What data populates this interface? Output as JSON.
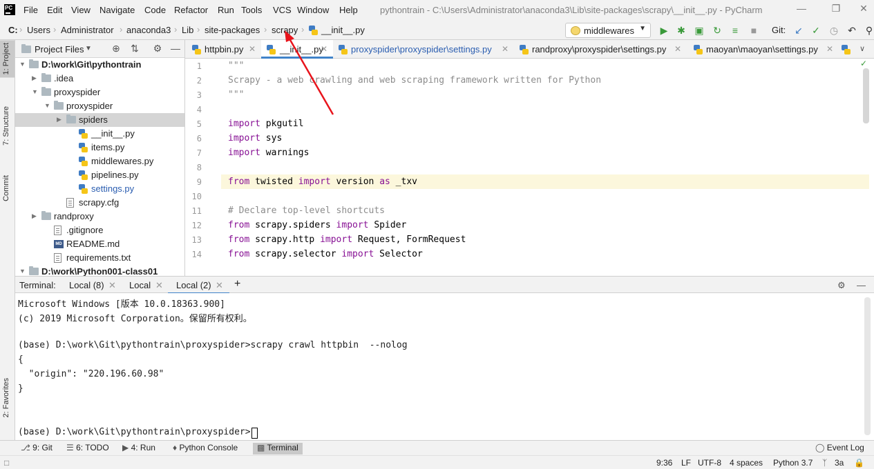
{
  "menu": {
    "items": [
      "File",
      "Edit",
      "View",
      "Navigate",
      "Code",
      "Refactor",
      "Run",
      "Tools",
      "VCS",
      "Window",
      "Help"
    ],
    "window_title": "pythontrain - C:\\Users\\Administrator\\anaconda3\\Lib\\site-packages\\scrapy\\__init__.py - PyCharm",
    "logo": "PC"
  },
  "breadcrumb": [
    "C:",
    "Users",
    "Administrator",
    "anaconda3",
    "Lib",
    "site-packages",
    "scrapy",
    "__init__.py"
  ],
  "toolbar": {
    "run_config": "middlewares",
    "git_label": "Git:"
  },
  "left_strip": {
    "project": "1: Project",
    "structure": "7: Structure",
    "commit": "Commit",
    "favorites": "2: Favorites"
  },
  "project_panel": {
    "title": "Project Files",
    "tree": [
      {
        "label": "D:\\work\\Git\\pythontrain",
        "type": "folder",
        "expanded": true,
        "bold": true
      },
      {
        "label": ".idea",
        "type": "folder",
        "expanded": false
      },
      {
        "label": "proxyspider",
        "type": "folder",
        "expanded": true
      },
      {
        "label": "proxyspider",
        "type": "folder",
        "expanded": true
      },
      {
        "label": "spiders",
        "type": "folder",
        "expanded": false,
        "selected": true
      },
      {
        "label": "__init__.py",
        "type": "py"
      },
      {
        "label": "items.py",
        "type": "py"
      },
      {
        "label": "middlewares.py",
        "type": "py"
      },
      {
        "label": "pipelines.py",
        "type": "py"
      },
      {
        "label": "settings.py",
        "type": "py",
        "modified": true
      },
      {
        "label": "scrapy.cfg",
        "type": "file"
      },
      {
        "label": "randproxy",
        "type": "folder",
        "expanded": false
      },
      {
        "label": ".gitignore",
        "type": "file"
      },
      {
        "label": "README.md",
        "type": "md"
      },
      {
        "label": "requirements.txt",
        "type": "file"
      },
      {
        "label": "D:\\work\\Python001-class01",
        "type": "folder",
        "expanded": true,
        "bold": true
      }
    ]
  },
  "editor_tabs": [
    {
      "label": "httpbin.py",
      "active": false
    },
    {
      "label": "__init__.py",
      "active": true
    },
    {
      "label": "proxyspider\\proxyspider\\settings.py",
      "active": false,
      "modified": true
    },
    {
      "label": "randproxy\\proxyspider\\settings.py",
      "active": false
    },
    {
      "label": "maoyan\\maoyan\\settings.py",
      "active": false
    }
  ],
  "editor": {
    "lines": [
      {
        "n": "1",
        "parts": [
          [
            "cm",
            "\"\"\""
          ]
        ]
      },
      {
        "n": "2",
        "parts": [
          [
            "cm",
            "Scrapy - a web crawling and web scraping framework written for Python"
          ]
        ]
      },
      {
        "n": "3",
        "parts": [
          [
            "cm",
            "\"\"\""
          ]
        ]
      },
      {
        "n": "4",
        "parts": []
      },
      {
        "n": "5",
        "parts": [
          [
            "kw2",
            "import"
          ],
          [
            "",
            " pkgutil"
          ]
        ]
      },
      {
        "n": "6",
        "parts": [
          [
            "kw2",
            "import"
          ],
          [
            "",
            " sys"
          ]
        ]
      },
      {
        "n": "7",
        "parts": [
          [
            "kw2",
            "import"
          ],
          [
            "",
            " warnings"
          ]
        ]
      },
      {
        "n": "8",
        "parts": []
      },
      {
        "n": "9",
        "parts": [
          [
            "kw2",
            "from"
          ],
          [
            "",
            " twisted "
          ],
          [
            "kw2",
            "import"
          ],
          [
            "",
            " version "
          ],
          [
            "kw2",
            "as"
          ],
          [
            "",
            " _txv"
          ]
        ]
      },
      {
        "n": "10",
        "parts": []
      },
      {
        "n": "11",
        "parts": [
          [
            "cm",
            "# Declare top-level shortcuts"
          ]
        ]
      },
      {
        "n": "12",
        "parts": [
          [
            "kw2",
            "from"
          ],
          [
            "",
            " scrapy.spiders "
          ],
          [
            "kw2",
            "import"
          ],
          [
            "",
            " Spider"
          ]
        ]
      },
      {
        "n": "13",
        "parts": [
          [
            "kw2",
            "from"
          ],
          [
            "",
            " scrapy.http "
          ],
          [
            "kw2",
            "import"
          ],
          [
            "",
            " Request, FormRequest"
          ]
        ]
      },
      {
        "n": "14",
        "parts": [
          [
            "kw2",
            "from"
          ],
          [
            "",
            " scrapy.selector "
          ],
          [
            "kw2",
            "import"
          ],
          [
            "",
            " Selector"
          ]
        ]
      }
    ]
  },
  "terminal": {
    "label": "Terminal:",
    "tabs": [
      "Local (8)",
      "Local",
      "Local (2)"
    ],
    "lines": [
      "Microsoft Windows [版本 10.0.18363.900]",
      "(c) 2019 Microsoft Corporation。保留所有权利。",
      "",
      "(base) D:\\work\\Git\\pythontrain\\proxyspider>scrapy crawl httpbin  --nolog",
      "{",
      "  \"origin\": \"220.196.60.98\"",
      "}",
      "",
      "",
      "(base) D:\\work\\Git\\pythontrain\\proxyspider>"
    ]
  },
  "bottom_tools": [
    "9: Git",
    "6: TODO",
    "4: Run",
    "Python Console",
    "Terminal"
  ],
  "event_log": "Event Log",
  "status": {
    "position": "9:36",
    "line_sep": "LF",
    "encoding": "UTF-8",
    "indent": "4 spaces",
    "interpreter": "Python 3.7",
    "branch": "3a"
  }
}
